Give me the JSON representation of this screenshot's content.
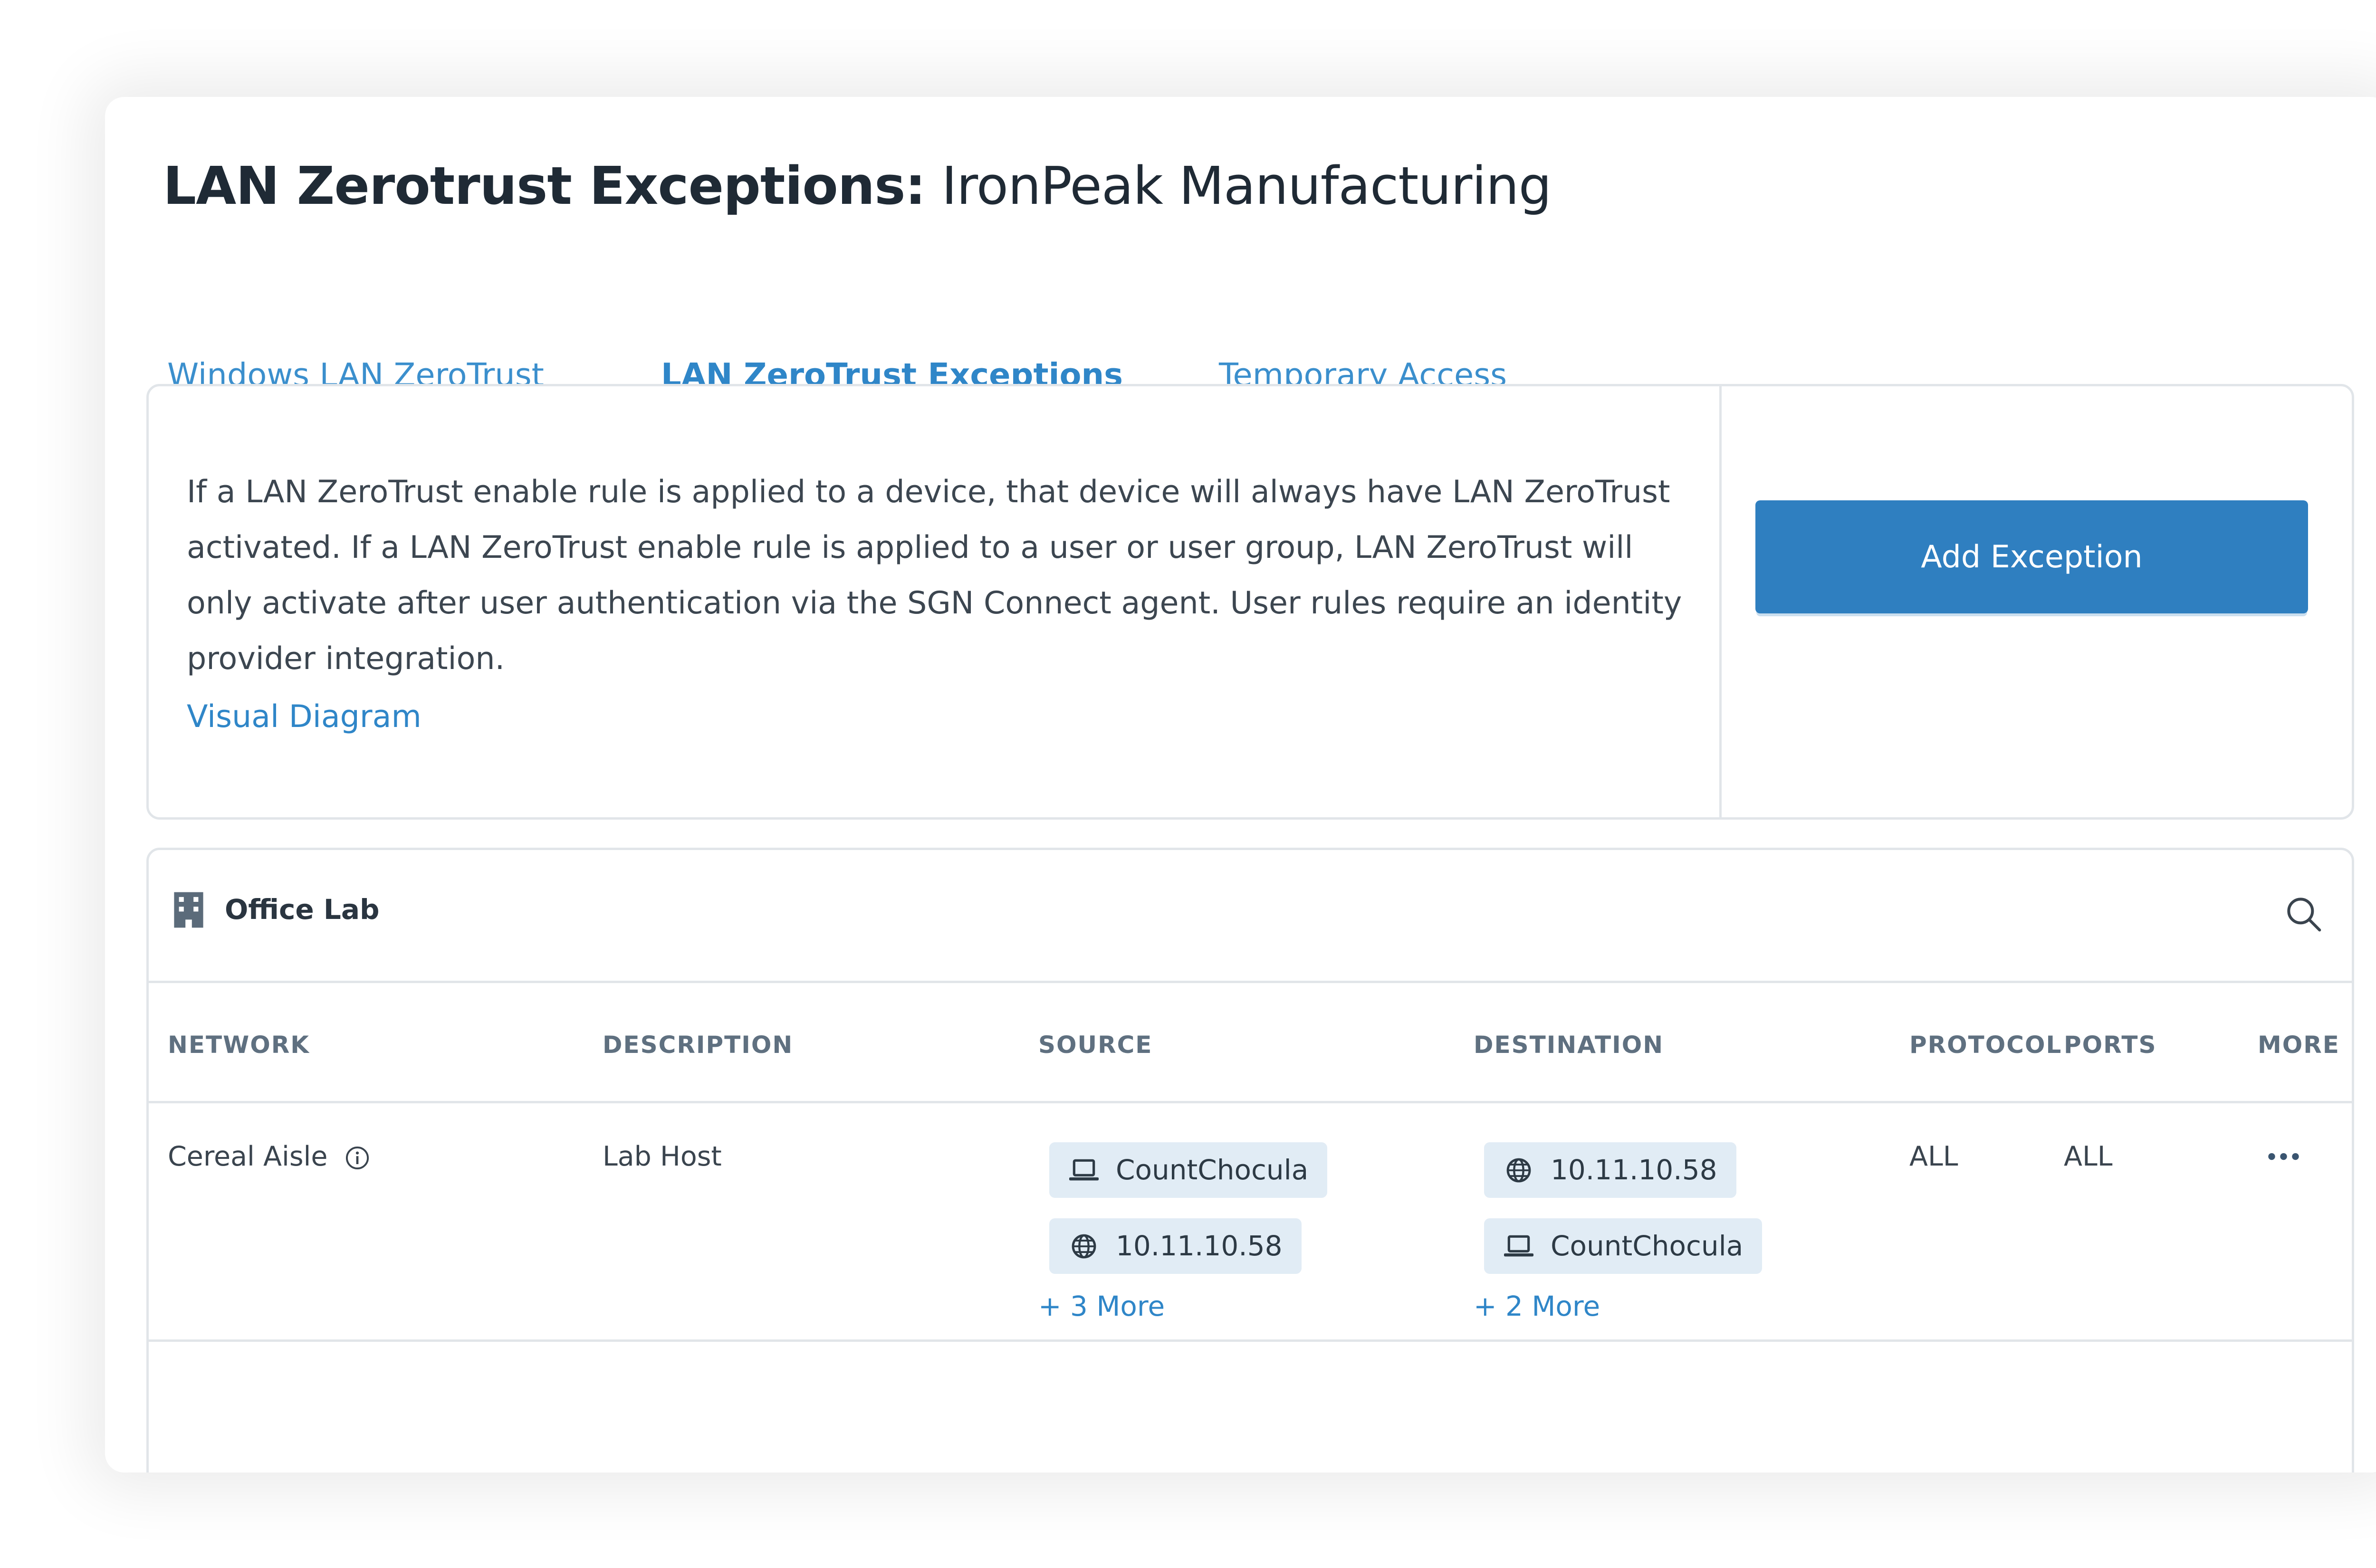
{
  "page": {
    "title_bold": "LAN Zerotrust Exceptions:",
    "title_org": "IronPeak Manufacturing"
  },
  "tabs": [
    {
      "label": "Windows LAN ZeroTrust",
      "active": false
    },
    {
      "label": "LAN ZeroTrust Exceptions",
      "active": true
    },
    {
      "label": "Temporary Access",
      "active": false
    }
  ],
  "info": {
    "text": "If a LAN ZeroTrust enable rule is applied to a device, that device will always have LAN ZeroTrust activated. If a LAN ZeroTrust enable rule is applied to a user or user group, LAN ZeroTrust will only activate after user authentication via the SGN Connect agent. User rules require an identity provider integration.",
    "link": "Visual Diagram",
    "add_button": "Add Exception"
  },
  "group": {
    "icon": "building-icon",
    "title": "Office Lab",
    "search_icon": "search-icon"
  },
  "table": {
    "headers": [
      "NETWORK",
      "DESCRIPTION",
      "SOURCE",
      "DESTINATION",
      "PROTOCOL",
      "PORTS",
      "MORE"
    ],
    "rows": [
      {
        "network": "Cereal Aisle",
        "description": "Lab Host",
        "source": [
          {
            "icon": "laptop-icon",
            "label": "CountChocula"
          },
          {
            "icon": "globe-icon",
            "label": "10.11.10.58"
          }
        ],
        "source_more": "+ 3 More",
        "destination": [
          {
            "icon": "globe-icon",
            "label": "10.11.10.58"
          },
          {
            "icon": "laptop-icon",
            "label": "CountChocula"
          }
        ],
        "destination_more": "+ 2 More",
        "protocol": "ALL",
        "ports": "ALL"
      }
    ]
  },
  "colors": {
    "accent": "#2f86c8",
    "button": "#2f7fc0",
    "chip": "#e1ecf5",
    "title": "#1f2a35"
  }
}
